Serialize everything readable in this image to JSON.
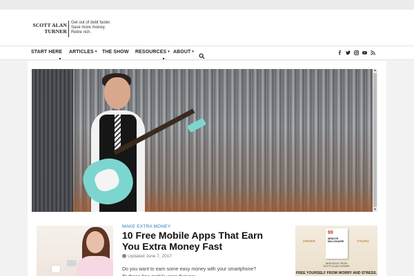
{
  "brand": {
    "name_line1": "SCOTT ALAN",
    "name_line2": "TURNER",
    "tagline_line1": "Get out of debt faster.",
    "tagline_line2": "Save more money.",
    "tagline_line3": "Retire rich."
  },
  "nav": {
    "items": [
      {
        "label": "START HERE",
        "has_caret": false
      },
      {
        "label": "ARTICLES",
        "has_caret": true
      },
      {
        "label": "THE SHOW",
        "has_caret": false
      },
      {
        "label": "RESOURCES",
        "has_caret": true
      },
      {
        "label": "ABOUT",
        "has_caret": true
      }
    ],
    "search_icon": "search-icon",
    "social_icons": [
      "facebook-icon",
      "twitter-icon",
      "instagram-icon",
      "youtube-icon",
      "rss-icon"
    ]
  },
  "hero": {
    "image": "man-with-guitar-photo"
  },
  "post": {
    "category": "MAKE EXTRA MONEY",
    "title": "10 Free Mobile Apps That Earn You Extra Money Fast",
    "meta_label": "Updated",
    "meta_date": "June 7, 2017",
    "excerpt": "Do you want to earn some easy money with your smartphone? To these free mobile apps that pay"
  },
  "ad": {
    "order_label": "ORDER",
    "yours_label": "YOURS",
    "book_number": "99",
    "book_word1": "MINUTE",
    "book_word2": "MILLIONAIRE",
    "new_book_line1": "NEW BOOK FROM",
    "new_book_line2": "SCOTT ALAN TURNER",
    "headline": "FREE YOURSELF FROM WORRY AND STRESS."
  },
  "colors": {
    "accent_link": "#2a7db8",
    "title_text": "#111111"
  }
}
